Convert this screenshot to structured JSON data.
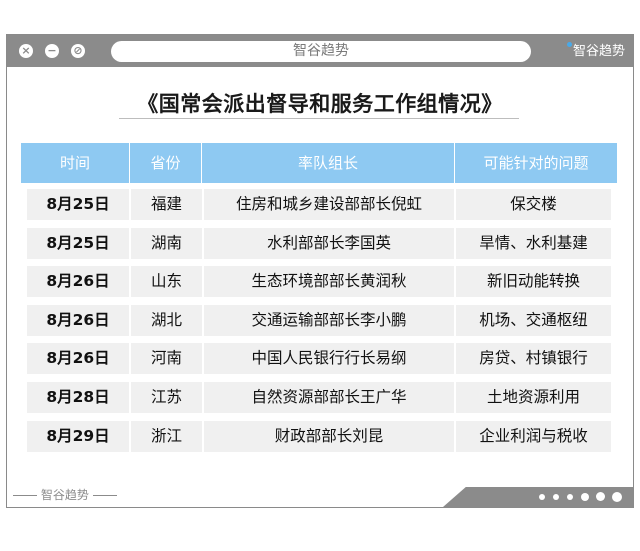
{
  "window": {
    "url_text": "智谷趋势",
    "brand": "智谷趋势",
    "footer_brand": "智谷趋势"
  },
  "title": "《国常会派出督导和服务工作组情况》",
  "table": {
    "headers": [
      "时间",
      "省份",
      "率队组长",
      "可能针对的问题"
    ],
    "rows": [
      {
        "date": "8月25日",
        "province": "福建",
        "leader": "住房和城乡建设部部长倪虹",
        "issue": "保交楼"
      },
      {
        "date": "8月25日",
        "province": "湖南",
        "leader": "水利部部长李国英",
        "issue": "旱情、水利基建"
      },
      {
        "date": "8月26日",
        "province": "山东",
        "leader": "生态环境部部长黄润秋",
        "issue": "新旧动能转换"
      },
      {
        "date": "8月26日",
        "province": "湖北",
        "leader": "交通运输部部长李小鹏",
        "issue": "机场、交通枢纽"
      },
      {
        "date": "8月26日",
        "province": "河南",
        "leader": "中国人民银行行长易纲",
        "issue": "房贷、村镇银行"
      },
      {
        "date": "8月28日",
        "province": "江苏",
        "leader": "自然资源部部长王广华",
        "issue": "土地资源利用"
      },
      {
        "date": "8月29日",
        "province": "浙江",
        "leader": "财政部部长刘昆",
        "issue": "企业利润与税收"
      }
    ]
  },
  "colors": {
    "header_bg": "#8ec9f2",
    "row_bg": "#f0f0f0",
    "chrome": "#8b8b8b"
  }
}
